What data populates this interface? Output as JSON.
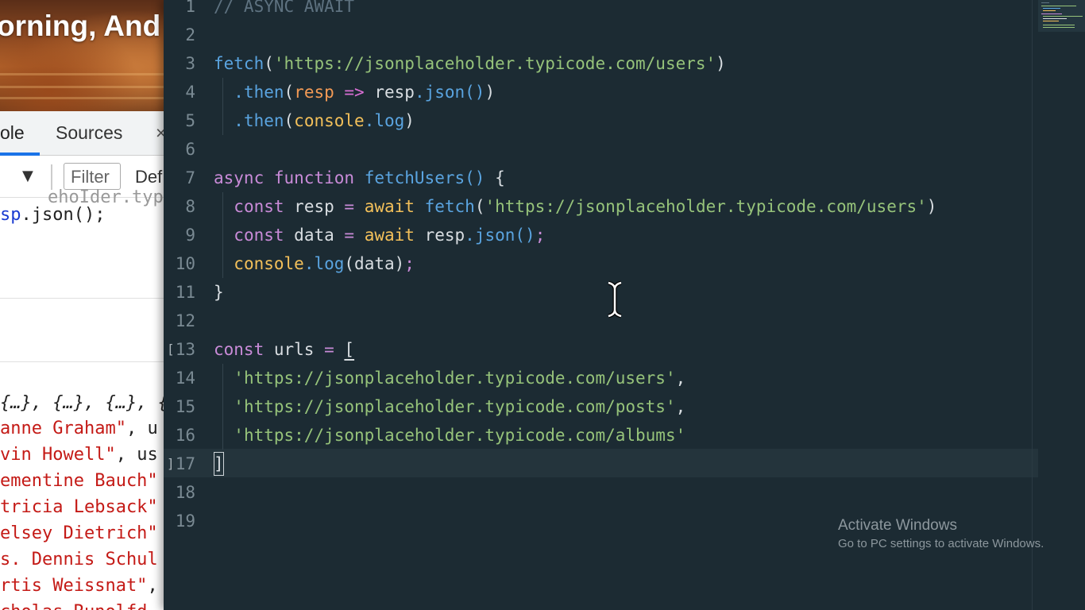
{
  "browser": {
    "greeting": "orning, And",
    "devtools": {
      "tabs": [
        "ole",
        "Sources",
        "×"
      ],
      "filter_placeholder": "Filter",
      "levels_label": "Def",
      "console_clipped": "ehoIder.typicod",
      "console_code_blue": "sp",
      "console_code_rest": ".json();",
      "array_preview": "{…}, {…}, {…}, {",
      "rows": [
        {
          "name": "anne Graham\"",
          "tail": ", u"
        },
        {
          "name": "vin Howell\"",
          "tail": ", us"
        },
        {
          "name": "ementine Bauch\"",
          "tail": ""
        },
        {
          "name": "tricia Lebsack\"",
          "tail": ""
        },
        {
          "name": "elsey Dietrich\"",
          "tail": ""
        },
        {
          "name": "s. Dennis Schul",
          "tail": ""
        },
        {
          "name": "rtis Weissnat\"",
          "tail": ","
        },
        {
          "name": "cholas Runolfd",
          "tail": ""
        }
      ]
    }
  },
  "editor": {
    "line_numbers": [
      "1",
      "2",
      "3",
      "4",
      "5",
      "6",
      "7",
      "8",
      "9",
      "10",
      "11",
      "12",
      "13",
      "14",
      "15",
      "16",
      "17",
      "18",
      "19"
    ],
    "code": {
      "l1": "// ASYNC AWAIT",
      "l3_fn": "fetch",
      "l3_str": "'https://jsonplaceholder.typicode.com/users'",
      "then": ".then",
      "resp": "resp",
      "arrow": "=>",
      "json_call": ".json()",
      "console": "console",
      "log": ".log",
      "async": "async",
      "function": "function",
      "fetchUsers": "fetchUsers",
      "const": "const",
      "await": "await",
      "data": "data",
      "urls": "urls",
      "url_users": "'https://jsonplaceholder.typicode.com/users'",
      "url_posts": "'https://jsonplaceholder.typicode.com/posts'",
      "url_albums": "'https://jsonplaceholder.typicode.com/albums'"
    },
    "active_line": 17
  },
  "watermark": {
    "title": "Activate Windows",
    "subtitle": "Go to PC settings to activate Windows."
  },
  "colors": {
    "editor_bg": "#1c2b33",
    "string": "#96c37a",
    "function": "#5aa4e0",
    "keyword": "#c98bd8",
    "param": "#f39a55",
    "object": "#f3c05a"
  }
}
